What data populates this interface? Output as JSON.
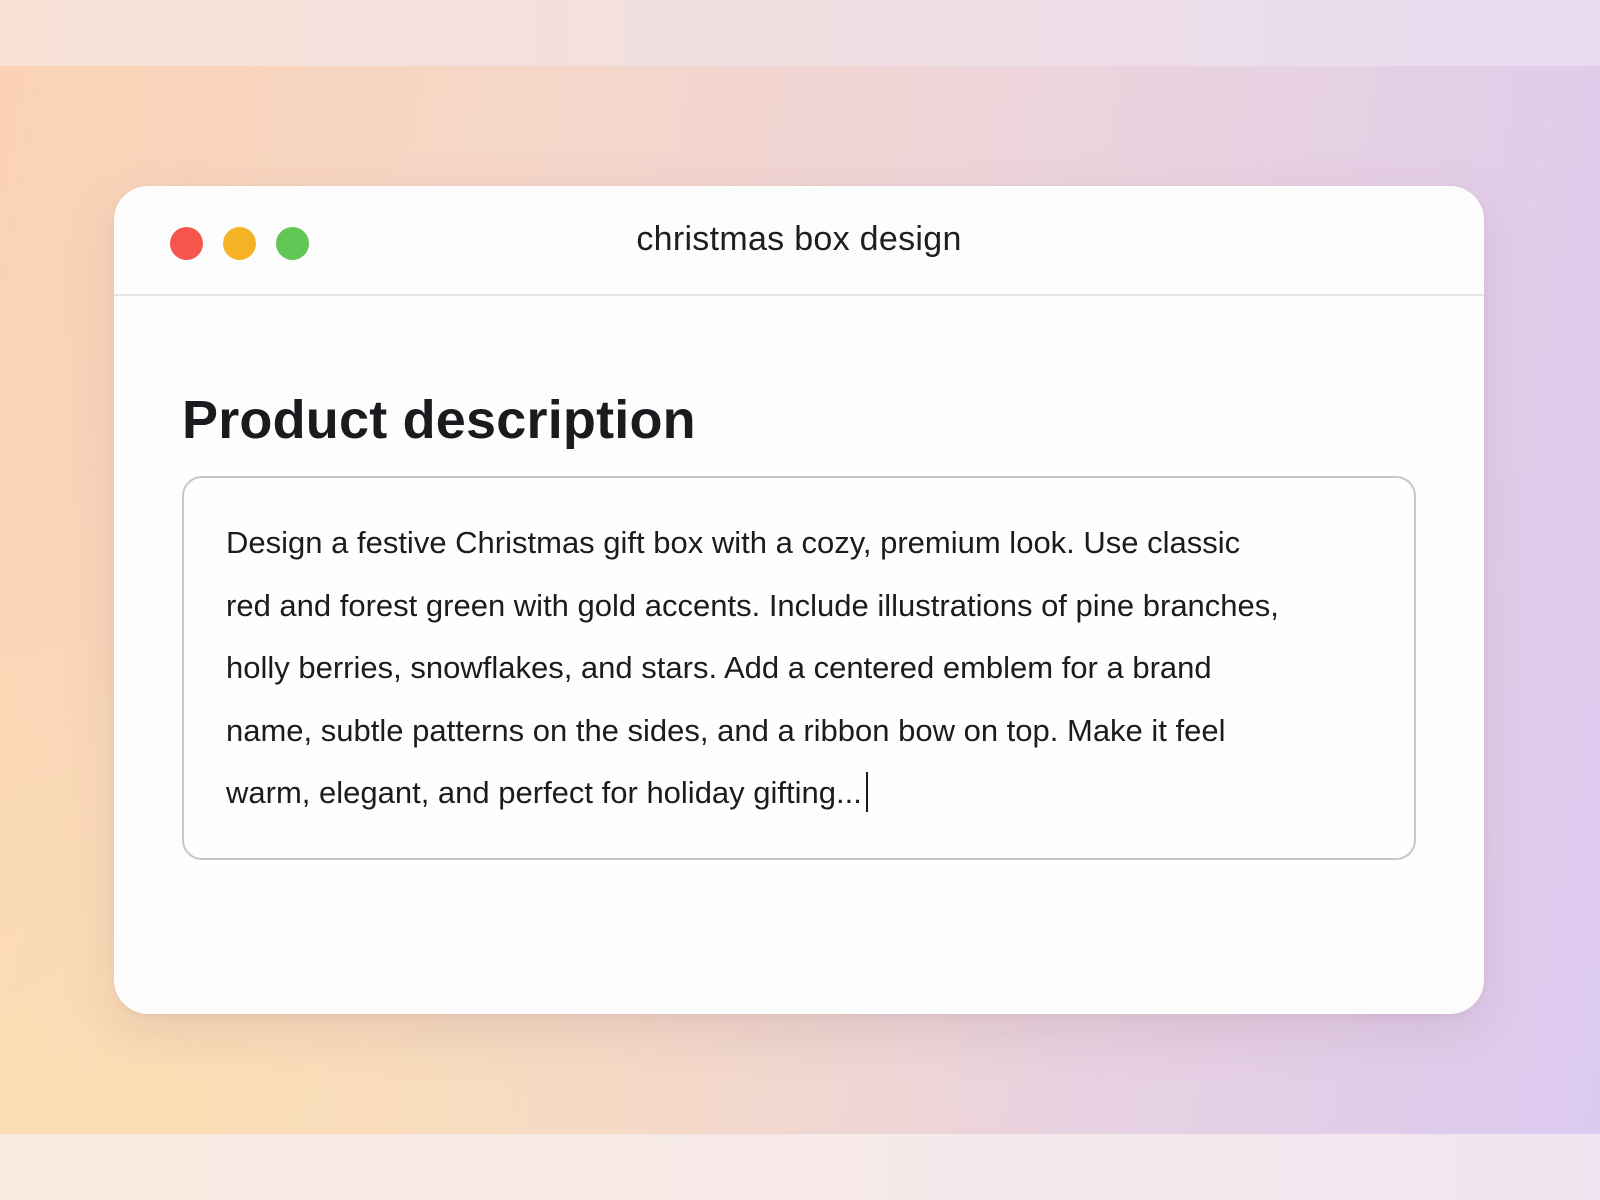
{
  "window": {
    "title": "christmas box design",
    "controls": {
      "close_color": "#f5554c",
      "minimize_color": "#f6b227",
      "zoom_color": "#61c654"
    }
  },
  "editor": {
    "heading": "Product description",
    "text": "Design a festive Christmas gift box with a cozy, premium look. Use classic\nred and forest green with gold accents. Include illustrations of pine branches,\nholly berries, snowflakes, and stars. Add a centered emblem for a brand\nname, subtle patterns on the sides, and a ribbon bow on top. Make it feel\nwarm, elegant, and perfect for holiday gifting..."
  }
}
